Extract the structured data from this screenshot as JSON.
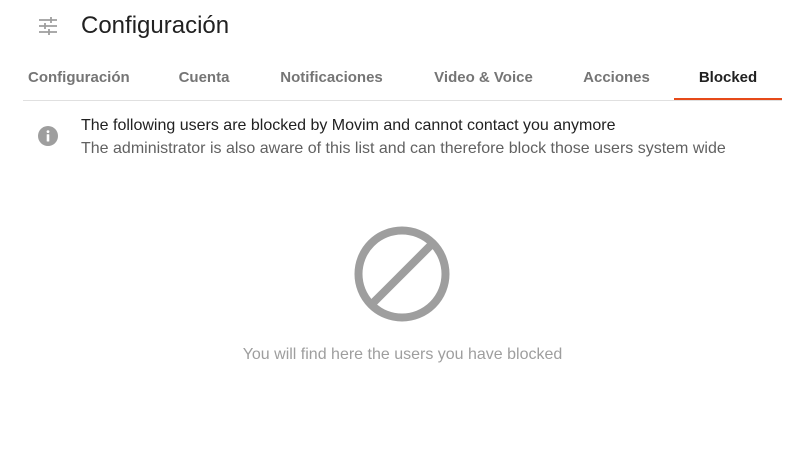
{
  "header": {
    "icon": "tune-icon",
    "title": "Configuración"
  },
  "tabs": [
    {
      "label": "Configuración",
      "active": false
    },
    {
      "label": "Cuenta",
      "active": false
    },
    {
      "label": "Notificaciones",
      "active": false
    },
    {
      "label": "Video & Voice",
      "active": false
    },
    {
      "label": "Acciones",
      "active": false
    },
    {
      "label": "Blocked",
      "active": true
    }
  ],
  "info": {
    "icon": "info-icon",
    "title": "The following users are blocked by Movim and cannot contact you anymore",
    "subtitle": "The administrator is also aware of this list and can therefore block those users system wide"
  },
  "empty_state": {
    "icon": "block-icon",
    "text": "You will find here the users you have blocked"
  },
  "colors": {
    "accent": "#e64a19",
    "icon_gray": "#9e9e9e",
    "text_primary": "#212121",
    "text_secondary": "#616161",
    "tab_inactive": "#757575",
    "divider": "#e0e0e0"
  }
}
